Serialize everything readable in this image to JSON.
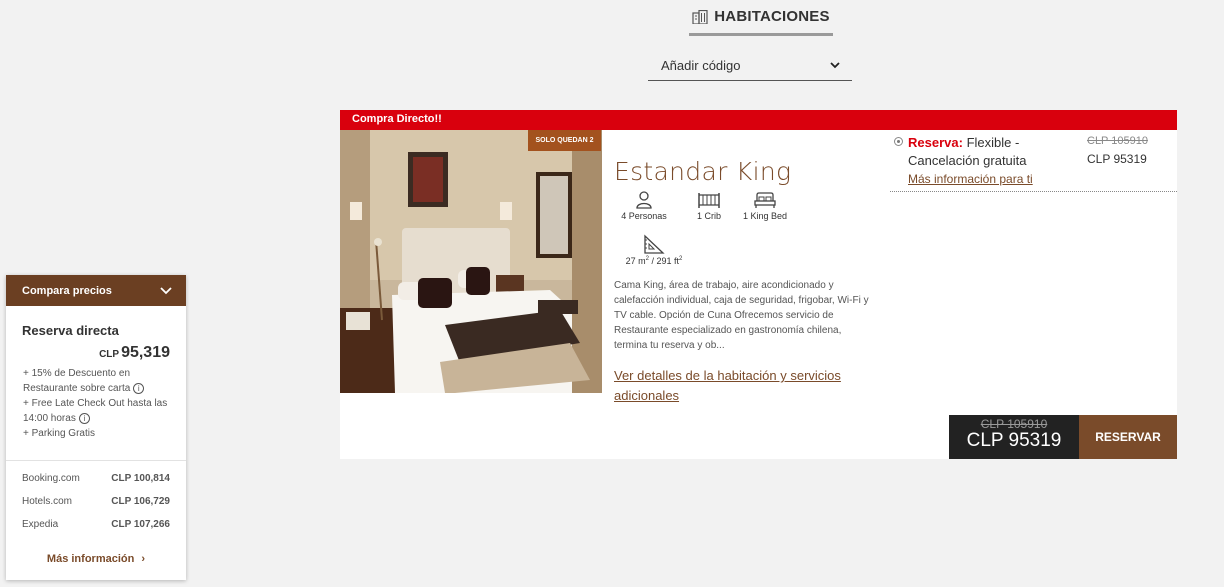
{
  "header": {
    "title": "HABITACIONES",
    "code_select": "Añadir código"
  },
  "colors": {
    "brand": "#7a4b2a",
    "banner": "#d9000d",
    "badge": "#a3521e",
    "price_box": "#222222"
  },
  "room": {
    "banner": "Compra Directo!!",
    "badge": "SOLO QUEDAN 2",
    "name": "Estandar King",
    "amenities": [
      {
        "icon": "person-icon",
        "label": "4 Personas"
      },
      {
        "icon": "crib-icon",
        "label": "1 Crib"
      },
      {
        "icon": "bed-icon",
        "label": "1 King Bed"
      }
    ],
    "area": {
      "m2": "27 m",
      "ft2": "291 ft",
      "sup": "2"
    },
    "description": "Cama King, área de trabajo, aire acondicionado y calefacción individual, caja de seguridad, frigobar, Wi-Fi y TV cable. Opción de Cuna Ofrecemos servicio de Restaurante especializado en gastronomía chilena, termina tu reserva y ob...",
    "details_link": "Ver detalles de la habitación y servicios adicionales",
    "rate": {
      "label": "Reserva:",
      "text": "Flexible - Cancelación gratuita",
      "more": "Más información para ti",
      "old_price": "CLP 105910",
      "new_price": "CLP 95319"
    },
    "price_box": {
      "old_price": "CLP 105910",
      "new_price": "CLP 95319"
    },
    "reserve_label": "RESERVAR"
  },
  "compare": {
    "title": "Compara precios",
    "direct_title": "Reserva directa",
    "direct_currency": "CLP",
    "direct_price": "95,319",
    "perk1": "+ 15% de Descuento en Restaurante sobre carta",
    "perk2": "+ Free Late Check Out hasta las 14:00 horas",
    "perk3": "+ Parking Gratis",
    "otas": [
      {
        "name": "Booking.com",
        "price": "CLP 100,814"
      },
      {
        "name": "Hotels.com",
        "price": "CLP 106,729"
      },
      {
        "name": "Expedia",
        "price": "CLP 107,266"
      }
    ],
    "more": "Más información"
  }
}
